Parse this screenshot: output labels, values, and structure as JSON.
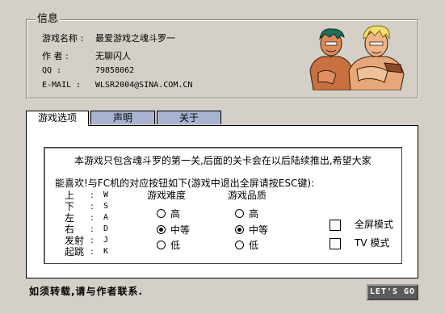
{
  "info": {
    "legend": "信息",
    "rows": [
      {
        "label": "游戏名称 :",
        "value": "最爱游戏之魂斗罗一"
      },
      {
        "label": "作    者 :",
        "value": "无聊闪人"
      },
      {
        "label": "QQ       :",
        "value": "79858062"
      },
      {
        "label": "E-MAIL   :",
        "value": "WLSR2004@SINA.COM.CN"
      }
    ]
  },
  "tabs": [
    {
      "label": "游戏选项",
      "selected": true
    },
    {
      "label": "声明",
      "selected": false
    },
    {
      "label": "关于",
      "selected": false
    }
  ],
  "panel": {
    "intro_line1": "本游戏只包含魂斗罗的第一关,后面的关卡会在以后陆续推出,希望大家",
    "intro_line2": "能喜欢!与FC机的对应按钮如下(游戏中退出全屏请按ESC键):",
    "keys": [
      {
        "action": "上",
        "key": "W"
      },
      {
        "action": "下",
        "key": "S"
      },
      {
        "action": "左",
        "key": "A"
      },
      {
        "action": "右",
        "key": "D"
      },
      {
        "action": "发射",
        "key": "J"
      },
      {
        "action": "起跳",
        "key": "K"
      }
    ],
    "difficulty": {
      "title": "游戏难度",
      "options": [
        {
          "label": "高",
          "checked": false
        },
        {
          "label": "中等",
          "checked": true
        },
        {
          "label": "低",
          "checked": false
        }
      ]
    },
    "quality": {
      "title": "游戏品质",
      "options": [
        {
          "label": "高",
          "checked": false
        },
        {
          "label": "中等",
          "checked": true
        },
        {
          "label": "低",
          "checked": false
        }
      ]
    },
    "fullscreen_label": "全屏模式",
    "tv_label": "TV 模式"
  },
  "footer": {
    "notice": "如须转载,请与作者联系.",
    "go_button": "LET'S GO"
  },
  "colors": {
    "background": "#d4d0c8",
    "tab_inactive": "#a8b4cf",
    "panel": "#ffffff",
    "button": "#5a5a5a"
  }
}
